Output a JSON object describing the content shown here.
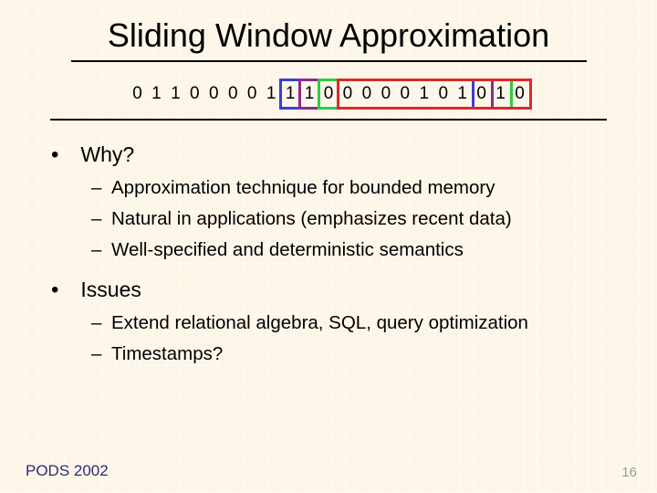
{
  "title": "Sliding Window Approximation",
  "bits": [
    "0",
    "1",
    "1",
    "0",
    "0",
    "0",
    "0",
    "1",
    "1",
    "1",
    "0",
    "0",
    "0",
    "0",
    "0",
    "1",
    "0",
    "1",
    "0",
    "1",
    "0"
  ],
  "windows": [
    {
      "color": "blue",
      "start": 9,
      "end": 19
    },
    {
      "color": "purple",
      "start": 10,
      "end": 20
    },
    {
      "color": "green",
      "start": 11,
      "end": 21
    },
    {
      "color": "red",
      "start": 12,
      "end": 22
    }
  ],
  "bullets": {
    "why": {
      "label": "Why?",
      "items": [
        "Approximation technique for bounded memory",
        "Natural in applications (emphasizes recent data)",
        "Well-specified and deterministic semantics"
      ]
    },
    "issues": {
      "label": "Issues",
      "items": [
        "Extend relational algebra, SQL, query optimization",
        "Timestamps?"
      ]
    }
  },
  "footer": {
    "left": "PODS 2002",
    "right": "16"
  }
}
